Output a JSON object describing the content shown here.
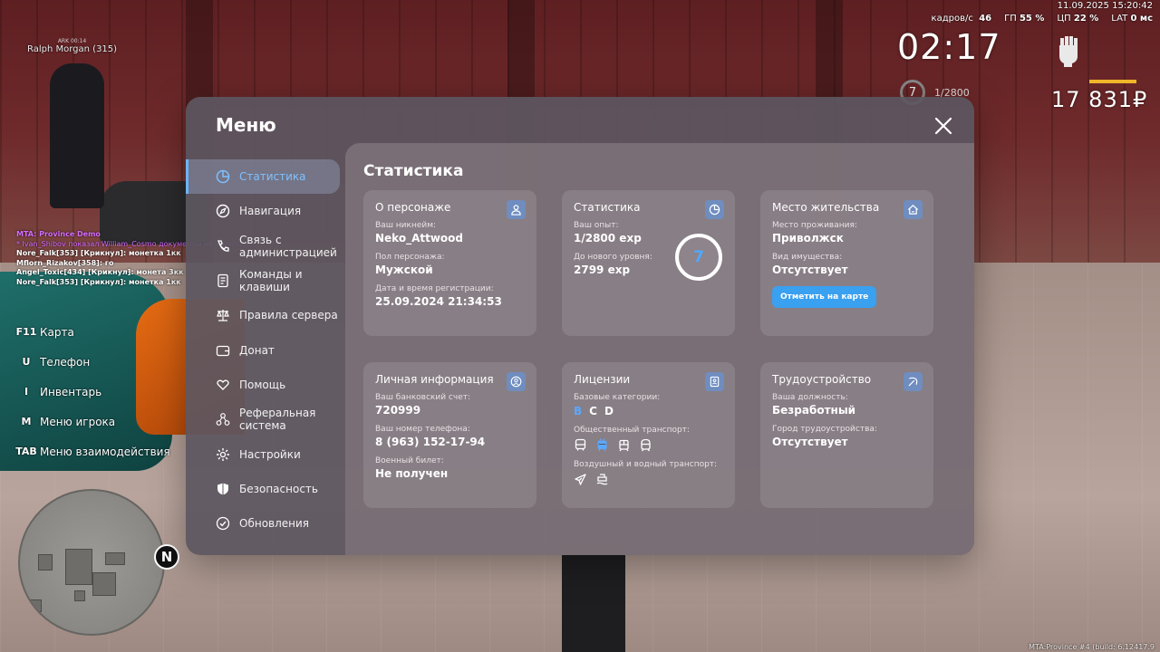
{
  "hud": {
    "datetime": "11.09.2025 15:20:42",
    "fps_label": "кадров/с",
    "fps_value": "46",
    "gpu_label": "ГП",
    "gpu_value": "55 %",
    "cpu_label": "ЦП",
    "cpu_value": "22 %",
    "lat_label": "LAT",
    "lat_value": "0 мс",
    "clock": "02:17",
    "level": "7",
    "exp_progress": "1/2800",
    "money": "17 831₽",
    "money_bar_color": "#f0b52a"
  },
  "player_tag": {
    "small": "ARK 00:14",
    "name": "Ralph Morgan (315)"
  },
  "chat": [
    "MTA: Province Demo",
    "* Ivan_Shibov показал William_Cosmo документы на транспорт",
    "Nore_Falk[353] [Крикнул]: монетка 1кк",
    "Mflorn_Rizakov[358]: го",
    "Angel_Toxic[434] [Крикнул]: монета 3кк",
    "Nore_Falk[353] [Крикнул]: монетка 1кк"
  ],
  "hotkeys": [
    {
      "key": "F11",
      "label": "Карта"
    },
    {
      "key": "U",
      "label": "Телефон"
    },
    {
      "key": "I",
      "label": "Инвентарь"
    },
    {
      "key": "M",
      "label": "Меню игрока"
    },
    {
      "key": "TAB",
      "label": "Меню взаимодействия"
    }
  ],
  "minimap": {
    "north": "N"
  },
  "build": "MTA:Province #4 (build: 6.12417.9",
  "menu": {
    "title": "Меню",
    "accent_color": "#6ab4ff",
    "nav": [
      {
        "label": "Статистика",
        "icon": "pie-chart-icon",
        "active": true
      },
      {
        "label": "Навигация",
        "icon": "compass-icon"
      },
      {
        "label": "Связь с администрацией",
        "icon": "phone-icon"
      },
      {
        "label": "Команды и клавиши",
        "icon": "document-icon"
      },
      {
        "label": "Правила сервера",
        "icon": "scales-icon"
      },
      {
        "label": "Донат",
        "icon": "wallet-icon"
      },
      {
        "label": "Помощь",
        "icon": "heart-hands-icon"
      },
      {
        "label": "Реферальная система",
        "icon": "network-icon"
      },
      {
        "label": "Настройки",
        "icon": "gear-icon"
      },
      {
        "label": "Безопасность",
        "icon": "shield-icon"
      },
      {
        "label": "Обновления",
        "icon": "update-check-icon"
      }
    ],
    "content_title": "Статистика",
    "cards": {
      "character": {
        "title": "О персонаже",
        "nickname_label": "Ваш никнейм:",
        "nickname": "Neko_Attwood",
        "gender_label": "Пол персонажа:",
        "gender": "Мужской",
        "reg_label": "Дата и время регистрации:",
        "reg": "25.09.2024 21:34:53"
      },
      "stats": {
        "title": "Статистика",
        "exp_label": "Ваш опыт:",
        "exp": "1/2800 exp",
        "next_label": "До нового уровня:",
        "next": "2799 exp",
        "level": "7"
      },
      "residence": {
        "title": "Место жительства",
        "place_label": "Место проживания:",
        "place": "Приволжск",
        "property_label": "Вид имущества:",
        "property": "Отсутствует",
        "button": "Отметить на карте"
      },
      "personal": {
        "title": "Личная информация",
        "bank_label": "Ваш банковский счет:",
        "bank": "720999",
        "phone_label": "Ваш номер телефона:",
        "phone": "8 (963) 152-17-94",
        "military_label": "Военный билет:",
        "military": "Не получен"
      },
      "licenses": {
        "title": "Лицензии",
        "base_label": "Базовые категории:",
        "categories": [
          {
            "name": "B",
            "owned": true
          },
          {
            "name": "C",
            "owned": false
          },
          {
            "name": "D",
            "owned": false
          }
        ],
        "public_label": "Общественный транспорт:",
        "public_icons": [
          "bus-icon",
          "trolleybus-icon",
          "tram-icon",
          "metro-icon"
        ],
        "public_active": "trolleybus-icon",
        "air_label": "Воздушный и водный транспорт:",
        "air_icons": [
          "plane-icon",
          "boat-icon"
        ]
      },
      "employment": {
        "title": "Трудоустройство",
        "position_label": "Ваша должность:",
        "position": "Безработный",
        "city_label": "Город трудоустройства:",
        "city": "Отсутствует"
      }
    }
  }
}
